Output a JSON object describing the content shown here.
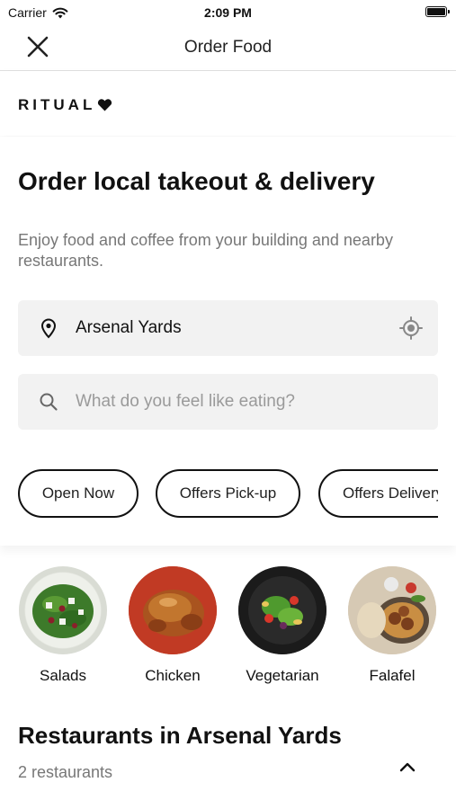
{
  "status_bar": {
    "carrier": "Carrier",
    "time": "2:09 PM"
  },
  "nav": {
    "title": "Order Food",
    "close_icon": "close-icon"
  },
  "brand": {
    "name": "RITUAL",
    "mark_icon": "heart-icon"
  },
  "hero": {
    "headline": "Order local takeout & delivery",
    "subtitle": "Enjoy food and coffee from your building and nearby restaurants.",
    "location": {
      "value": "Arsenal Yards",
      "icon": "location-pin-icon",
      "action_icon": "current-location-icon"
    },
    "search": {
      "placeholder": "What do you feel like eating?",
      "value": "",
      "icon": "search-icon"
    },
    "filters": [
      "Open Now",
      "Offers Pick-up",
      "Offers Delivery"
    ]
  },
  "categories": [
    {
      "label": "Salads"
    },
    {
      "label": "Chicken"
    },
    {
      "label": "Vegetarian"
    },
    {
      "label": "Falafel"
    }
  ],
  "restaurants_section": {
    "title": "Restaurants in Arsenal Yards",
    "count": "2 restaurants",
    "toggle_icon": "chevron-up-icon"
  }
}
